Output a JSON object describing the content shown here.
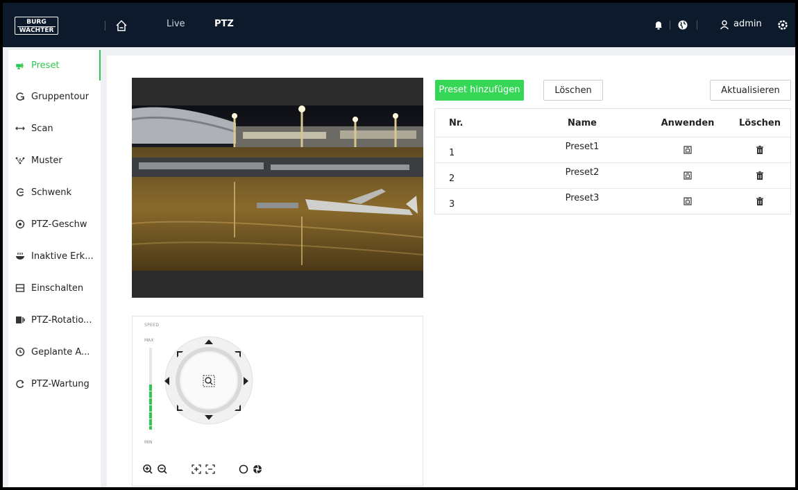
{
  "header": {
    "logo_top": "BURG",
    "logo_bottom": "WÄCHTER",
    "nav": {
      "live": "Live",
      "ptz": "PTZ"
    },
    "user": "admin",
    "icons": [
      "home-icon",
      "bell-icon",
      "globe-icon",
      "user-icon",
      "gear-icon"
    ]
  },
  "sidebar": {
    "items": [
      {
        "label": "Preset",
        "icon": "preset-icon",
        "active": true
      },
      {
        "label": "Gruppentour",
        "icon": "tour-icon"
      },
      {
        "label": "Scan",
        "icon": "scan-icon"
      },
      {
        "label": "Muster",
        "icon": "pattern-icon"
      },
      {
        "label": "Schwenk",
        "icon": "pan-icon"
      },
      {
        "label": "PTZ-Geschw",
        "icon": "speed-icon"
      },
      {
        "label": "Inaktive Erk...",
        "icon": "idle-icon"
      },
      {
        "label": "Einschalten",
        "icon": "power-up-icon"
      },
      {
        "label": "PTZ-Rotatio...",
        "icon": "rotation-icon"
      },
      {
        "label": "Geplante A...",
        "icon": "clock-icon"
      },
      {
        "label": "PTZ-Wartung",
        "icon": "maintenance-icon"
      }
    ]
  },
  "toolbar": {
    "add_label": "Preset hinzufügen",
    "delete_label": "Löschen",
    "refresh_label": "Aktualisieren"
  },
  "table": {
    "headers": {
      "nr": "Nr.",
      "name": "Name",
      "apply": "Anwenden",
      "delete": "Löschen"
    },
    "rows": [
      {
        "nr": "1",
        "name": "Preset1"
      },
      {
        "nr": "2",
        "name": "Preset2"
      },
      {
        "nr": "3",
        "name": "Preset3"
      }
    ]
  },
  "ptz_control": {
    "speed_label": "SPEED",
    "max_label": "MAX",
    "min_label": "MIN",
    "speed_level": 0.55
  },
  "colors": {
    "accent": "#2ec850",
    "topbar": "#0c1a2b",
    "button_green": "#36d656"
  }
}
